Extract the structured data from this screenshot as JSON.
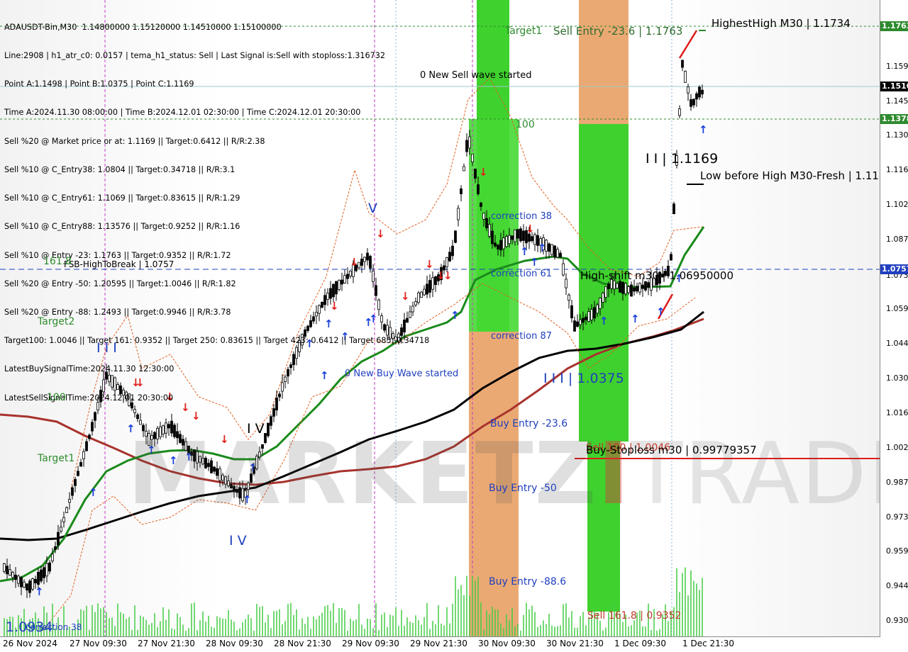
{
  "header": {
    "lines": [
      "ADAUSDT-Bin,M30  1.14800000 1.15120000 1.14510000 1.15100000",
      "Line:2908 | h1_atr_c0: 0.0157 | tema_h1_status: Sell | Last Signal is:Sell with stoploss:1.316732",
      "Point A:1.1498 | Point B:1.0375 | Point C:1.1169",
      "Time A:2024.11.30 08:00:00 | Time B:2024.12.01 02:30:00 | Time C:2024.12.01 20:30:00",
      "Sell %20 @ Market price or at: 1.1169 || Target:0.6412 || R/R:2.38",
      "Sell %10 @ C_Entry38: 1.0804 || Target:0.34718 || R/R:3.1",
      "Sell %10 @ C_Entry61: 1.1069 || Target:0.83615 || R/R:1.29",
      "Sell %10 @ C_Entry88: 1.13576 || Target:0.9252 || R/R:1.16",
      "Sell %10 @ Entry -23: 1.1763 || Target:0.9352 || R/R:1.72",
      "Sell %20 @ Entry -50: 1.20595 || Target:1.0046 || R/R:1.82",
      "Sell %20 @ Entry -88: 1.2493 || Target:0.9946 || R/R:3.78",
      "Target100: 1.0046 || Target 161: 0.9352 || Target 250: 0.83615 || Target 423: 0.6412 || Target 685: 0.34718",
      "LatestBuySignalTime:2024.11.30 12:30:00",
      "LatestSellSignalTime:2024.12.01 20:30:00"
    ]
  },
  "price_axis": {
    "ticks": [
      "1.159",
      "1.145",
      "1.130",
      "1.116",
      "1.102",
      "1.087",
      "1.073",
      "1.059",
      "1.044",
      "1.030",
      "1.016",
      "1.002",
      "0.987",
      "0.973",
      "0.959",
      "0.944",
      "0.930"
    ],
    "tags": [
      {
        "text": "1.1763",
        "color": "#2e8b2e"
      },
      {
        "text": "1.1510",
        "color": "#000000"
      },
      {
        "text": "1.1378",
        "color": "#2e8b2e"
      },
      {
        "text": "1.0757",
        "color": "#1f3fbf"
      }
    ]
  },
  "time_axis": {
    "labels": [
      "26 Nov 2024",
      "27 Nov 09:30",
      "27 Nov 21:30",
      "28 Nov 09:30",
      "28 Nov 21:30",
      "29 Nov 09:30",
      "29 Nov 21:30",
      "30 Nov 09:30",
      "30 Nov 21:30",
      "1 Dec 09:30",
      "1 Dec 21:30"
    ]
  },
  "annotations": {
    "target1_top": "Target1",
    "sell_entry": "Sell Entry -23.6 | 1.1763",
    "highest_high": "HighestHigh   M30 | 1.1734",
    "new_sell_wave": "0 New Sell wave started",
    "hundred_top": "100",
    "ii_1169": "I I | 1.1169",
    "low_before_high": "Low before High   M30-Fresh | 1.11",
    "correction38": "correction 38",
    "correction61": "correction 61",
    "correction87": "correction 87",
    "fsb": "FSB-HighToBreak | 1.0757",
    "fib161": "161.8",
    "high_shift": "High-shift m30 | 1.06950000",
    "target2": "Target2",
    "three_i": "I I I",
    "new_buy_wave": "0 New Buy Wave started",
    "iii_1037": "I I I | 1.0375",
    "hundred_left": "100",
    "iv": "I V",
    "v": "V",
    "buy_entry_23": "Buy Entry -23.6",
    "sell_100": "Sell 100 | 1.0046",
    "buy_stoploss": "Buy-Stoploss m30 | 0.99779357",
    "target1_left": "Target1",
    "buy_entry_50": "Buy Entry -50",
    "buy_entry_88": "Buy Entry -88.6",
    "sell_161": "Sell 161.8 | 0.9352",
    "bottom_ii": "I V",
    "bottom_left_price": "1.0934",
    "correction38_bottom": "correction 38"
  },
  "watermark": {
    "part1": "MARKETZ",
    "part2": "I",
    "part3": "TRADE"
  },
  "colors": {
    "bull": "#000000",
    "bear": "#000000",
    "green_zone": "#3fd12e",
    "orange_zone": "#e8a064",
    "ma_green": "#1a8a1a",
    "ma_black": "#000000",
    "ma_red": "#a8322d",
    "buy_arrow": "#1a3fd9",
    "sell_arrow": "#e0201a"
  }
}
